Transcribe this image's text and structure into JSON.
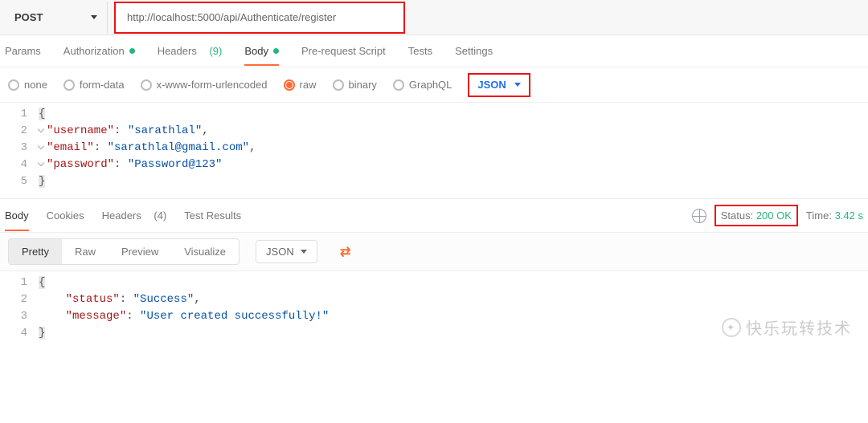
{
  "request": {
    "method": "POST",
    "url": "http://localhost:5000/api/Authenticate/register"
  },
  "req_tabs": {
    "params": "Params",
    "authorization": "Authorization",
    "headers_label": "Headers",
    "headers_count": "(9)",
    "body": "Body",
    "prerequest": "Pre-request Script",
    "tests": "Tests",
    "settings": "Settings"
  },
  "body_types": {
    "none": "none",
    "formdata": "form-data",
    "urlencoded": "x-www-form-urlencoded",
    "raw": "raw",
    "binary": "binary",
    "graphql": "GraphQL",
    "content_dd": "JSON"
  },
  "req_body_lines": [
    {
      "n": "1",
      "html": "<span class='brace'>{</span>"
    },
    {
      "n": "2",
      "html": "<span class='fold'></span><span class='key'>\"username\"</span><span class='punc'>: </span><span class='str'>\"sarathlal\"</span><span class='punc'>,</span>"
    },
    {
      "n": "3",
      "html": "<span class='fold'></span><span class='key'>\"email\"</span><span class='punc'>: </span><span class='str'>\"sarathlal@gmail.com\"</span><span class='punc'>,</span>"
    },
    {
      "n": "4",
      "html": "<span class='fold'></span><span class='key'>\"password\"</span><span class='punc'>: </span><span class='str'>\"Password@123\"</span>"
    },
    {
      "n": "5",
      "html": "<span class='brace'>}</span>"
    }
  ],
  "res_tabs": {
    "body": "Body",
    "cookies": "Cookies",
    "headers_label": "Headers",
    "headers_count": "(4)",
    "tests": "Test Results"
  },
  "response_meta": {
    "status_label": "Status:",
    "status_value": "200 OK",
    "time_label": "Time:",
    "time_value": "3.42 s"
  },
  "view_modes": {
    "pretty": "Pretty",
    "raw": "Raw",
    "preview": "Preview",
    "visualize": "Visualize",
    "lang_dd": "JSON"
  },
  "res_body_lines": [
    {
      "n": "1",
      "html": "<span class='brace'>{</span>"
    },
    {
      "n": "2",
      "html": "    <span class='key'>\"status\"</span><span class='punc'>: </span><span class='str'>\"Success\"</span><span class='punc'>,</span>"
    },
    {
      "n": "3",
      "html": "    <span class='key'>\"message\"</span><span class='punc'>: </span><span class='str'>\"User created successfully!\"</span>"
    },
    {
      "n": "4",
      "html": "<span class='brace'>}</span>"
    }
  ],
  "watermark": "快乐玩转技术"
}
